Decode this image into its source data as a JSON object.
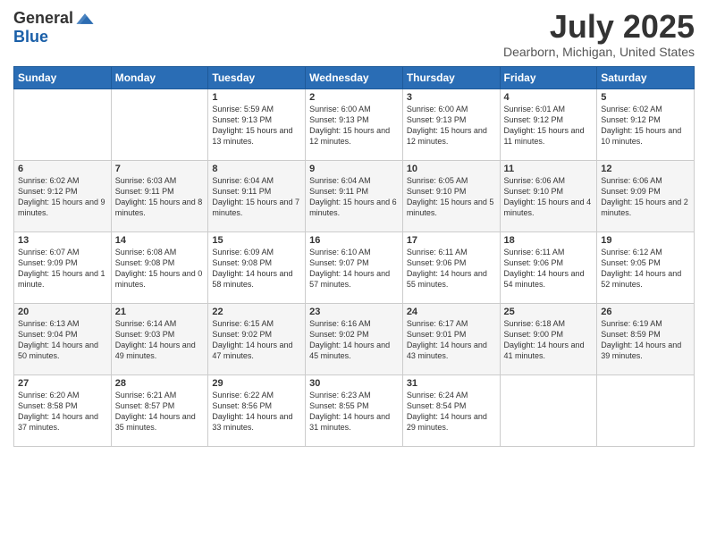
{
  "logo": {
    "general": "General",
    "blue": "Blue"
  },
  "title": "July 2025",
  "subtitle": "Dearborn, Michigan, United States",
  "days_header": [
    "Sunday",
    "Monday",
    "Tuesday",
    "Wednesday",
    "Thursday",
    "Friday",
    "Saturday"
  ],
  "weeks": [
    [
      {
        "day": "",
        "info": ""
      },
      {
        "day": "",
        "info": ""
      },
      {
        "day": "1",
        "info": "Sunrise: 5:59 AM\nSunset: 9:13 PM\nDaylight: 15 hours and 13 minutes."
      },
      {
        "day": "2",
        "info": "Sunrise: 6:00 AM\nSunset: 9:13 PM\nDaylight: 15 hours and 12 minutes."
      },
      {
        "day": "3",
        "info": "Sunrise: 6:00 AM\nSunset: 9:13 PM\nDaylight: 15 hours and 12 minutes."
      },
      {
        "day": "4",
        "info": "Sunrise: 6:01 AM\nSunset: 9:12 PM\nDaylight: 15 hours and 11 minutes."
      },
      {
        "day": "5",
        "info": "Sunrise: 6:02 AM\nSunset: 9:12 PM\nDaylight: 15 hours and 10 minutes."
      }
    ],
    [
      {
        "day": "6",
        "info": "Sunrise: 6:02 AM\nSunset: 9:12 PM\nDaylight: 15 hours and 9 minutes."
      },
      {
        "day": "7",
        "info": "Sunrise: 6:03 AM\nSunset: 9:11 PM\nDaylight: 15 hours and 8 minutes."
      },
      {
        "day": "8",
        "info": "Sunrise: 6:04 AM\nSunset: 9:11 PM\nDaylight: 15 hours and 7 minutes."
      },
      {
        "day": "9",
        "info": "Sunrise: 6:04 AM\nSunset: 9:11 PM\nDaylight: 15 hours and 6 minutes."
      },
      {
        "day": "10",
        "info": "Sunrise: 6:05 AM\nSunset: 9:10 PM\nDaylight: 15 hours and 5 minutes."
      },
      {
        "day": "11",
        "info": "Sunrise: 6:06 AM\nSunset: 9:10 PM\nDaylight: 15 hours and 4 minutes."
      },
      {
        "day": "12",
        "info": "Sunrise: 6:06 AM\nSunset: 9:09 PM\nDaylight: 15 hours and 2 minutes."
      }
    ],
    [
      {
        "day": "13",
        "info": "Sunrise: 6:07 AM\nSunset: 9:09 PM\nDaylight: 15 hours and 1 minute."
      },
      {
        "day": "14",
        "info": "Sunrise: 6:08 AM\nSunset: 9:08 PM\nDaylight: 15 hours and 0 minutes."
      },
      {
        "day": "15",
        "info": "Sunrise: 6:09 AM\nSunset: 9:08 PM\nDaylight: 14 hours and 58 minutes."
      },
      {
        "day": "16",
        "info": "Sunrise: 6:10 AM\nSunset: 9:07 PM\nDaylight: 14 hours and 57 minutes."
      },
      {
        "day": "17",
        "info": "Sunrise: 6:11 AM\nSunset: 9:06 PM\nDaylight: 14 hours and 55 minutes."
      },
      {
        "day": "18",
        "info": "Sunrise: 6:11 AM\nSunset: 9:06 PM\nDaylight: 14 hours and 54 minutes."
      },
      {
        "day": "19",
        "info": "Sunrise: 6:12 AM\nSunset: 9:05 PM\nDaylight: 14 hours and 52 minutes."
      }
    ],
    [
      {
        "day": "20",
        "info": "Sunrise: 6:13 AM\nSunset: 9:04 PM\nDaylight: 14 hours and 50 minutes."
      },
      {
        "day": "21",
        "info": "Sunrise: 6:14 AM\nSunset: 9:03 PM\nDaylight: 14 hours and 49 minutes."
      },
      {
        "day": "22",
        "info": "Sunrise: 6:15 AM\nSunset: 9:02 PM\nDaylight: 14 hours and 47 minutes."
      },
      {
        "day": "23",
        "info": "Sunrise: 6:16 AM\nSunset: 9:02 PM\nDaylight: 14 hours and 45 minutes."
      },
      {
        "day": "24",
        "info": "Sunrise: 6:17 AM\nSunset: 9:01 PM\nDaylight: 14 hours and 43 minutes."
      },
      {
        "day": "25",
        "info": "Sunrise: 6:18 AM\nSunset: 9:00 PM\nDaylight: 14 hours and 41 minutes."
      },
      {
        "day": "26",
        "info": "Sunrise: 6:19 AM\nSunset: 8:59 PM\nDaylight: 14 hours and 39 minutes."
      }
    ],
    [
      {
        "day": "27",
        "info": "Sunrise: 6:20 AM\nSunset: 8:58 PM\nDaylight: 14 hours and 37 minutes."
      },
      {
        "day": "28",
        "info": "Sunrise: 6:21 AM\nSunset: 8:57 PM\nDaylight: 14 hours and 35 minutes."
      },
      {
        "day": "29",
        "info": "Sunrise: 6:22 AM\nSunset: 8:56 PM\nDaylight: 14 hours and 33 minutes."
      },
      {
        "day": "30",
        "info": "Sunrise: 6:23 AM\nSunset: 8:55 PM\nDaylight: 14 hours and 31 minutes."
      },
      {
        "day": "31",
        "info": "Sunrise: 6:24 AM\nSunset: 8:54 PM\nDaylight: 14 hours and 29 minutes."
      },
      {
        "day": "",
        "info": ""
      },
      {
        "day": "",
        "info": ""
      }
    ]
  ]
}
